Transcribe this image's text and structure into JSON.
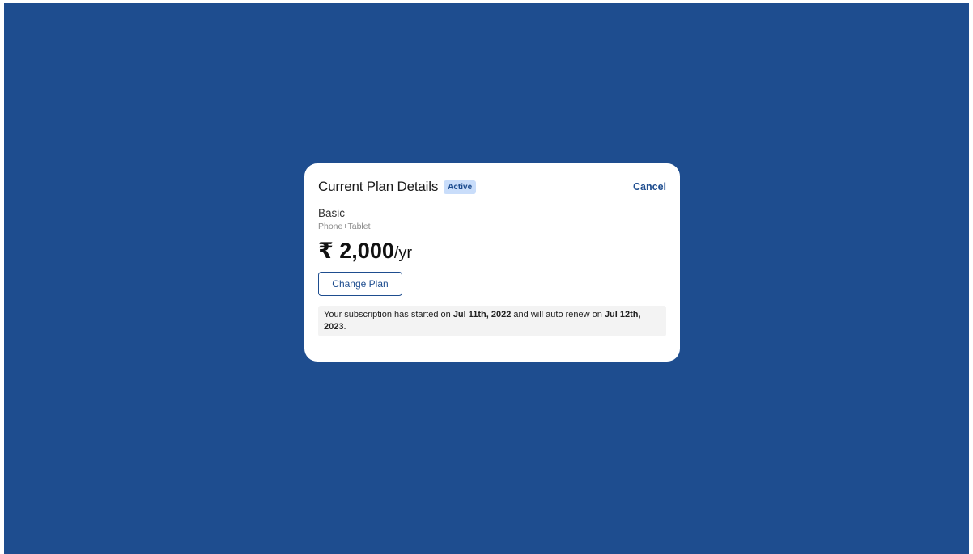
{
  "colors": {
    "background": "#1e4d8f",
    "accent": "#1e4d8f",
    "badge_bg": "#c9ddfa",
    "card": "#ffffff",
    "notice_bg": "#f3f3f3"
  },
  "card": {
    "title": "Current Plan Details",
    "status_badge": "Active",
    "cancel_label": "Cancel",
    "plan_name": "Basic",
    "plan_devices": "Phone+Tablet",
    "price_amount": "₹ 2,000",
    "price_period": "/yr",
    "change_plan_label": "Change Plan",
    "notice": {
      "prefix": "Your subscription has started on ",
      "start_date": "Jul 11th, 2022",
      "middle": " and will auto renew on ",
      "renew_date": "Jul 12th, 2023",
      "suffix": "."
    }
  }
}
